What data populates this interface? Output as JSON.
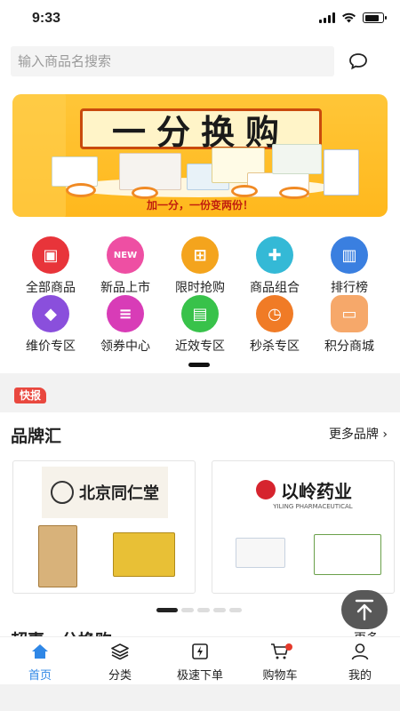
{
  "status": {
    "time": "9:33"
  },
  "search": {
    "placeholder": "输入商品名搜索",
    "message_icon": "chat-bubble-icon"
  },
  "banner": {
    "title": "一分换购",
    "subtitle": "加一分，一份变两份！",
    "colors": {
      "background": "#ffbe2c",
      "frame": "#c94a0d",
      "subtitle": "#c11e0e"
    }
  },
  "categories": [
    {
      "label": "全部商品",
      "icon": "all-products-icon",
      "color": "#e8343a"
    },
    {
      "label": "新品上市",
      "icon": "new-icon",
      "color": "#ee4fa3"
    },
    {
      "label": "限时抢购",
      "icon": "cart-sale-icon",
      "color": "#f4a41d"
    },
    {
      "label": "商品组合",
      "icon": "puzzle-icon",
      "color": "#34b9d6"
    },
    {
      "label": "排行榜",
      "icon": "ranking-icon",
      "color": "#3a7fe0"
    },
    {
      "label": "维价专区",
      "icon": "diamond-icon",
      "color": "#8a4fdc"
    },
    {
      "label": "领券中心",
      "icon": "coupon-icon",
      "color": "#d83cb7"
    },
    {
      "label": "近效专区",
      "icon": "medicine-bottle-icon",
      "color": "#38c24a"
    },
    {
      "label": "秒杀专区",
      "icon": "stopwatch-icon",
      "color": "#f07b26"
    },
    {
      "label": "积分商城",
      "icon": "points-card-icon",
      "color": "#f6a86a"
    }
  ],
  "news": {
    "tag": "快报"
  },
  "brands": {
    "title": "品牌汇",
    "more": "更多品牌 ›",
    "cards": [
      {
        "logo_text": "北京同仁堂",
        "logo_icon": "tongrentang-seal-icon"
      },
      {
        "logo_text": "以岭药业",
        "logo_sub": "YILING PHARMACEUTICAL",
        "logo_icon": "yiling-logo-icon"
      }
    ],
    "next_section_title": "超惠一分换购",
    "next_section_more": "更多"
  },
  "back_to_top": {
    "icon": "arrow-to-top-icon"
  },
  "tabs": [
    {
      "label": "首页",
      "icon": "home-icon",
      "active": true
    },
    {
      "label": "分类",
      "icon": "layers-icon",
      "active": false
    },
    {
      "label": "极速下单",
      "icon": "flash-order-icon",
      "active": false
    },
    {
      "label": "购物车",
      "icon": "cart-icon",
      "active": false,
      "badge": true
    },
    {
      "label": "我的",
      "icon": "user-icon",
      "active": false
    }
  ],
  "colors": {
    "accent": "#2f87e6",
    "badge": "#e53a2b",
    "news_tag": "#e9483f"
  }
}
